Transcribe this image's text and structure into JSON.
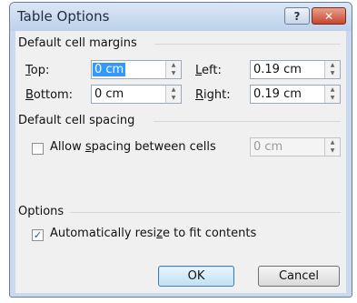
{
  "window": {
    "title": "Table Options",
    "help_label": "?",
    "close_label": "✕"
  },
  "margins": {
    "section_title": "Default cell margins",
    "top": {
      "pre": "",
      "mn": "T",
      "post": "op:",
      "value": "0 cm"
    },
    "bottom": {
      "pre": "",
      "mn": "B",
      "post": "ottom:",
      "value": "0 cm"
    },
    "left": {
      "pre": "",
      "mn": "L",
      "post": "eft:",
      "value": "0.19 cm"
    },
    "right": {
      "pre": "",
      "mn": "R",
      "post": "ight:",
      "value": "0.19 cm"
    }
  },
  "spacing": {
    "section_title": "Default cell spacing",
    "allow_pre": "Allow ",
    "allow_mn": "s",
    "allow_post": "pacing between cells",
    "allow_checked": false,
    "value": "0 cm"
  },
  "options": {
    "section_title": "Options",
    "autoresize_pre": "Automatically resi",
    "autoresize_mn": "z",
    "autoresize_post": "e to fit contents",
    "autoresize_checked": true
  },
  "buttons": {
    "ok": "OK",
    "cancel": "Cancel"
  },
  "glyphs": {
    "check": "✓",
    "spin_up": "▲",
    "spin_down": "▼"
  }
}
